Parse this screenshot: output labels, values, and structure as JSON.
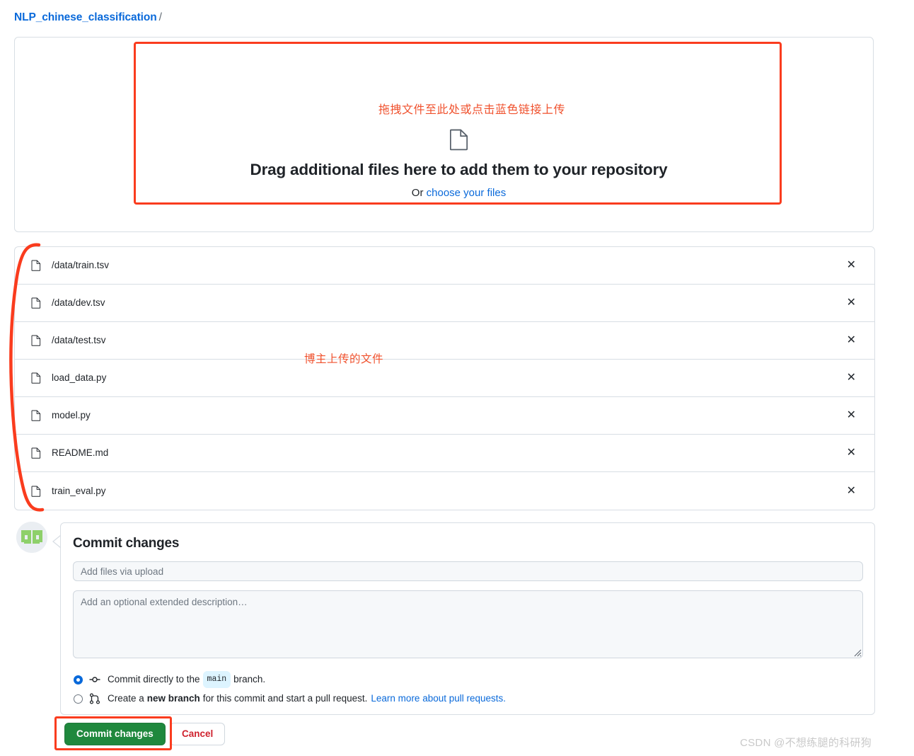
{
  "breadcrumb": {
    "repo": "NLP_chinese_classification",
    "separator": "/"
  },
  "dropzone": {
    "annotation_zh": "拖拽文件至此处或点击蓝色链接上传",
    "headline": "Drag additional files here to add them to your repository",
    "or_label": "Or",
    "choose_link": "choose your files",
    "file_icon": "file-icon"
  },
  "file_list": {
    "annotation_zh": "博主上传的文件",
    "remove_label": "✕",
    "items": [
      {
        "name": "/data/train.tsv"
      },
      {
        "name": "/data/dev.tsv"
      },
      {
        "name": "/data/test.tsv"
      },
      {
        "name": "load_data.py"
      },
      {
        "name": "model.py"
      },
      {
        "name": "README.md"
      },
      {
        "name": "train_eval.py"
      }
    ]
  },
  "commit": {
    "title": "Commit changes",
    "message_placeholder": "Add files via upload",
    "message_value": "",
    "description_placeholder": "Add an optional extended description…",
    "description_value": "",
    "options": {
      "direct": {
        "selected": true,
        "text_before": "Commit directly to the",
        "branch": "main",
        "text_after": "branch.",
        "icon": "git-commit-icon"
      },
      "new_branch": {
        "selected": false,
        "text_before": "Create a",
        "bold": "new branch",
        "text_after": "for this commit and start a pull request.",
        "link": "Learn more about pull requests.",
        "icon": "git-pull-request-icon"
      }
    },
    "submit_label": "Commit changes",
    "cancel_label": "Cancel"
  },
  "watermark": {
    "text": "CSDN @不想练腿的科研狗"
  },
  "colors": {
    "link_blue": "#0969da",
    "annotation_red": "#fa3c1e",
    "annotation_text_red": "#f0512d",
    "commit_green": "#1f883d",
    "cancel_red": "#cf222e",
    "branch_badge_bg": "#ddf4ff",
    "border_gray": "#d8dee4",
    "input_bg": "#f6f8fa"
  }
}
